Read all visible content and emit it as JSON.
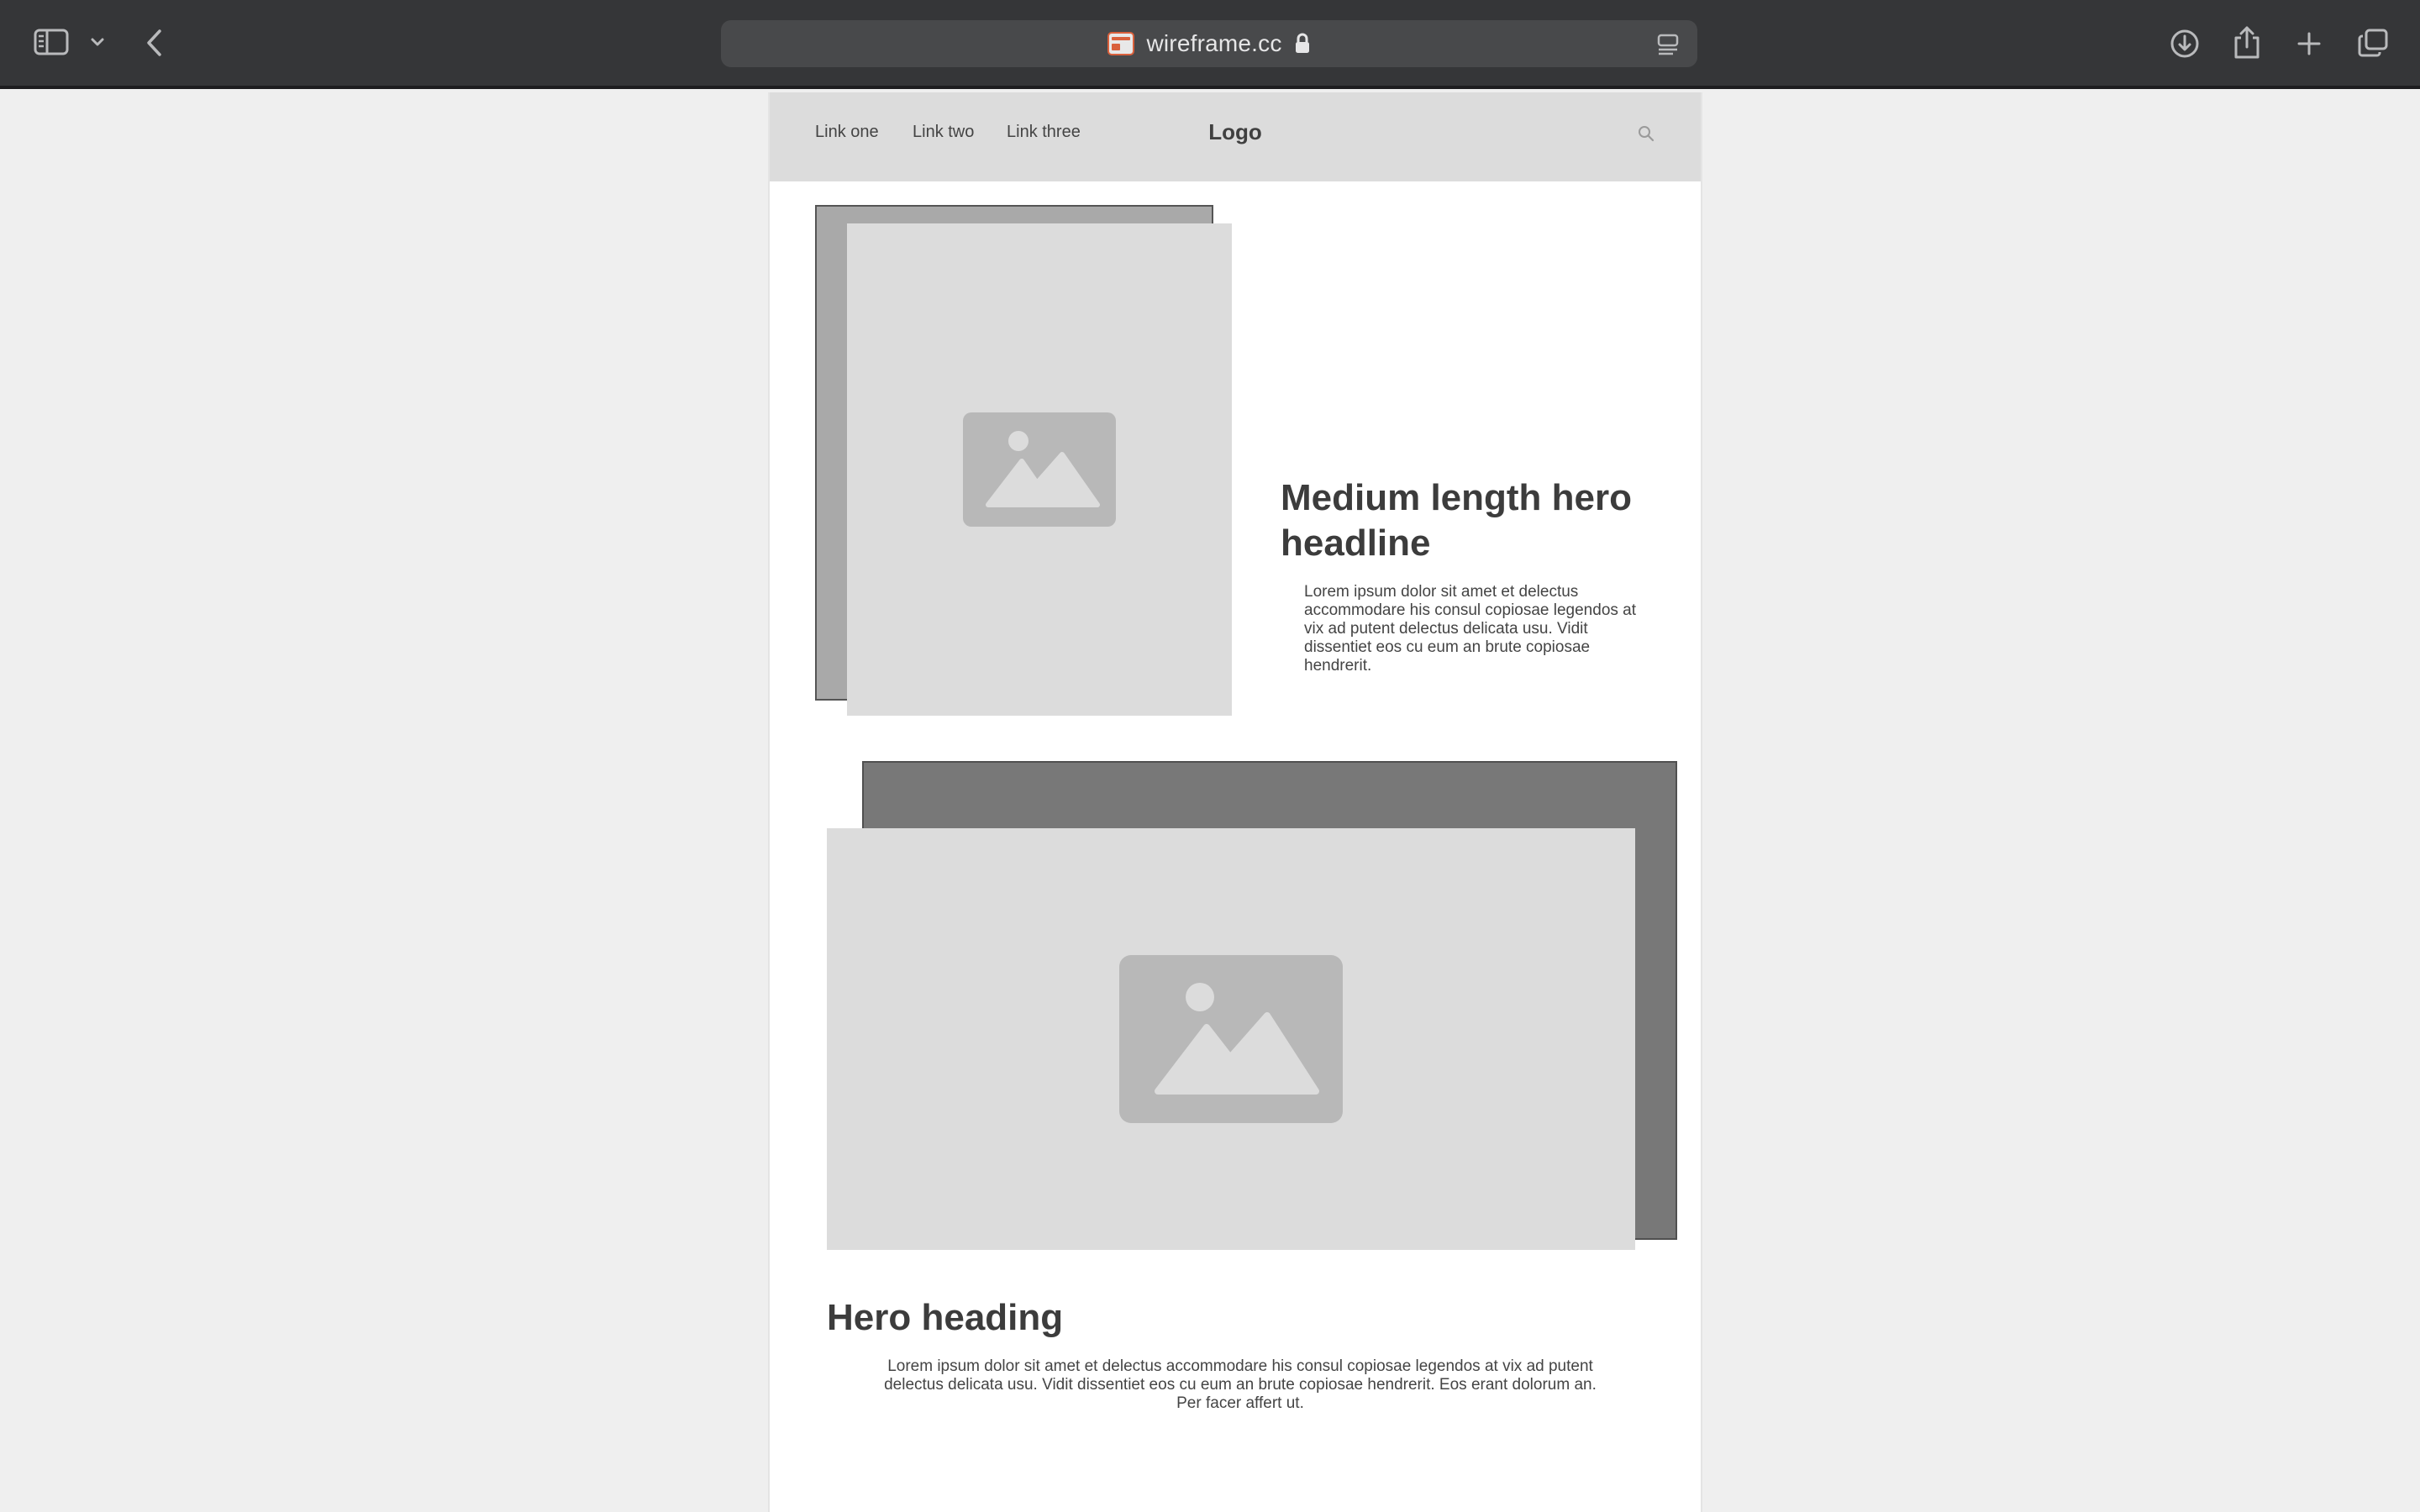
{
  "browser": {
    "url": "wireframe.cc",
    "secure": true,
    "toolbar_icons": [
      "sidebar-icon",
      "chevron-down-icon",
      "back-icon",
      "favicon",
      "lock-icon",
      "reader-icon",
      "download-icon",
      "share-icon",
      "new-tab-plus-icon",
      "tab-overview-icon"
    ]
  },
  "site": {
    "nav": {
      "links": [
        "Link one",
        "Link two",
        "Link three"
      ],
      "logo": "Logo",
      "search_icon": "search-icon"
    },
    "hero1": {
      "headline": "Medium length hero headline",
      "body": "Lorem ipsum dolor sit amet et delectus accommodare his consul copiosae legendos at vix ad putent delectus delicata usu. Vidit dissentiet eos cu eum an brute copiosae hendrerit.",
      "image_icon": "image-placeholder-icon"
    },
    "hero2": {
      "heading": "Hero heading",
      "body": "Lorem ipsum dolor sit amet et delectus accommodare his consul copiosae legendos at vix ad putent delectus delicata usu. Vidit dissentiet eos cu eum an brute copiosae hendrerit. Eos erant dolorum an. Per facer affert ut.",
      "image_icon": "image-placeholder-icon"
    }
  },
  "colors": {
    "chrome_bg": "#353638",
    "address_bg": "#48494b",
    "window_bg": "#efefef",
    "nav_bg": "#dcdcdc",
    "placeholder_bg": "#dcdcdc",
    "shadow_light": "#a9a9a9",
    "shadow_dark": "#787878",
    "text": "#3c3c3c"
  }
}
